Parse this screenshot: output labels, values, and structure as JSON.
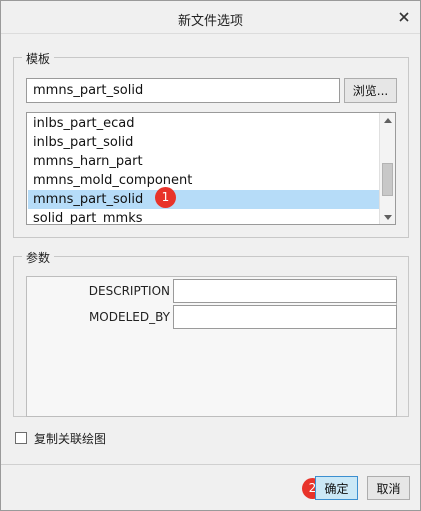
{
  "window": {
    "title": "新文件选项",
    "close_icon": "close-icon"
  },
  "template": {
    "group_title": "模板",
    "input_value": "mmns_part_solid",
    "browse_label": "浏览...",
    "list_items": [
      "inlbs_part_ecad",
      "inlbs_part_solid",
      "mmns_harn_part",
      "mmns_mold_component",
      "mmns_part_solid",
      "solid_part_mmks"
    ],
    "selected_index": 4,
    "annotation_1": "1"
  },
  "params": {
    "group_title": "参数",
    "rows": [
      {
        "label": "DESCRIPTION",
        "value": ""
      },
      {
        "label": "MODELED_BY",
        "value": ""
      }
    ]
  },
  "copy_drawing": {
    "label": "复制关联绘图",
    "checked": false
  },
  "footer": {
    "ok_label": "确定",
    "cancel_label": "取消",
    "annotation_2": "2"
  },
  "colors": {
    "selected_row": "#b6dcf8",
    "ok_button": "#cbe8f6",
    "badge": "#e8332a"
  }
}
